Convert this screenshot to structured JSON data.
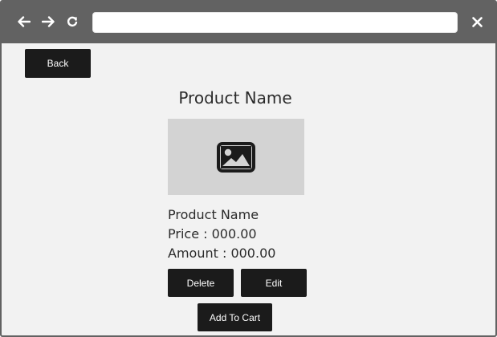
{
  "browser": {
    "url": "",
    "icons": {
      "back": "arrow-left-icon",
      "forward": "arrow-right-icon",
      "reload": "reload-icon",
      "close": "close-icon"
    }
  },
  "page": {
    "back_label": "Back",
    "title": "Product Name",
    "image_icon": "image-icon",
    "product": {
      "name": "Product Name",
      "price": "Price : 000.00",
      "amount": "Amount : 000.00"
    },
    "actions": {
      "delete_label": "Delete",
      "edit_label": "Edit",
      "add_to_cart_label": "Add To Cart"
    }
  },
  "colors": {
    "chrome": "#626262",
    "page_bg": "#f2f2f2",
    "button_bg": "#1b1b1b",
    "image_bg": "#d3d3d3"
  }
}
